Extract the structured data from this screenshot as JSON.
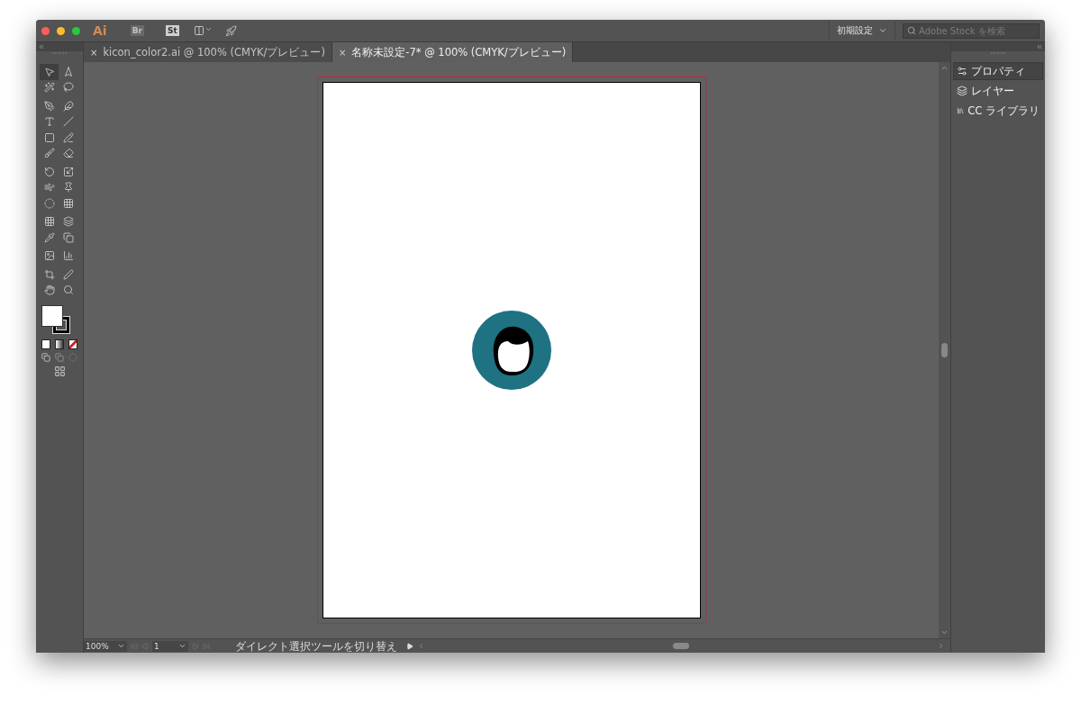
{
  "app": {
    "logo": "Ai",
    "bridge": "Br",
    "stock": "St"
  },
  "workspace": {
    "label": "初期設定"
  },
  "search": {
    "placeholder": "Adobe Stock を検索"
  },
  "tabs": [
    {
      "close": "×",
      "label": "kicon_color2.ai @ 100% (CMYK/プレビュー)",
      "selected": false
    },
    {
      "close": "×",
      "label": "名称未設定-7* @ 100% (CMYK/プレビュー)",
      "selected": true
    }
  ],
  "panels": [
    {
      "label": "プロパティ",
      "selected": true
    },
    {
      "label": "レイヤー",
      "selected": false
    },
    {
      "label": "CC ライブラリ",
      "selected": false
    }
  ],
  "status_bar": {
    "zoom": "100%",
    "artboard": "1",
    "message": "ダイレクト選択ツールを切り替え"
  }
}
